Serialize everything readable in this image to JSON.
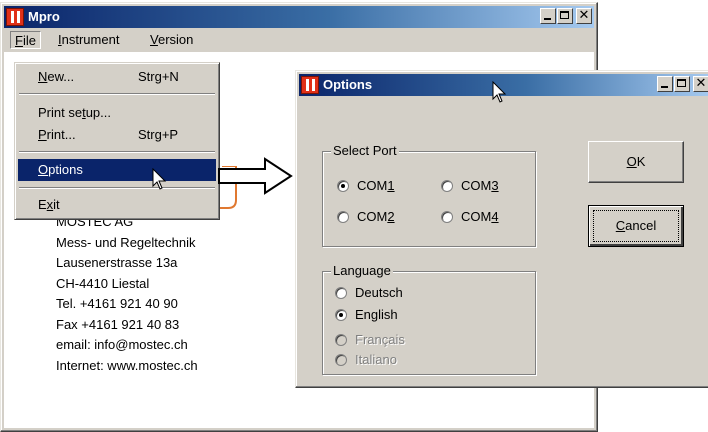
{
  "main_window": {
    "title": "Mpro",
    "menu": [
      {
        "prefix": "",
        "accel": "F",
        "rest": "ile"
      },
      {
        "prefix": "",
        "accel": "I",
        "rest": "nstrument"
      },
      {
        "prefix": "",
        "accel": "V",
        "rest": "ersion"
      }
    ]
  },
  "file_menu": {
    "new": {
      "prefix": "",
      "accel": "N",
      "rest": "ew...",
      "shortcut": "Strg+N"
    },
    "print_setup": {
      "prefix": "Print se",
      "accel": "t",
      "rest": "up..."
    },
    "print": {
      "prefix": "",
      "accel": "P",
      "rest": "rint...",
      "shortcut": "Strg+P"
    },
    "options": {
      "prefix": "",
      "accel": "O",
      "rest": "ptions"
    },
    "exit": {
      "prefix": "E",
      "accel": "x",
      "rest": "it"
    }
  },
  "contact": {
    "lines": [
      "MOSTEC AG",
      "Mess- und Regeltechnik",
      "Lausenerstrasse 13a",
      "CH-4410 Liestal",
      "Tel. +4161 921 40 90",
      "Fax +4161 921 40 83",
      "email: info@mostec.ch",
      "Internet: www.mostec.ch"
    ]
  },
  "options_dialog": {
    "title": "Options",
    "port_group": {
      "label": "Select Port",
      "options": [
        {
          "prefix": "COM",
          "accel": "1",
          "selected": true
        },
        {
          "prefix": "COM",
          "accel": "2",
          "selected": false
        },
        {
          "prefix": "COM",
          "accel": "3",
          "selected": false
        },
        {
          "prefix": "COM",
          "accel": "4",
          "selected": false
        }
      ]
    },
    "language_group": {
      "label": "Language",
      "options": [
        {
          "label": "Deutsch",
          "selected": false,
          "enabled": true
        },
        {
          "label": "English",
          "selected": true,
          "enabled": true
        },
        {
          "label": "Français",
          "selected": false,
          "enabled": false
        },
        {
          "label": "Italiano",
          "selected": false,
          "enabled": false
        }
      ]
    },
    "ok_button": {
      "accel": "O",
      "rest": "K"
    },
    "cancel_button": {
      "accel": "C",
      "rest": "ancel"
    }
  },
  "colors": {
    "title_active": "#0a246a",
    "title_gradient_end": "#a6caf0",
    "window_face": "#d4d0c8",
    "menu_highlight": "#0a246a",
    "logo_red": "#e03018",
    "logo_outline_orange": "#e07830"
  },
  "icons": {
    "app": "mpro-app-icon",
    "cursor": "mouse-pointer-icon",
    "arrow": "right-arrow-icon"
  }
}
